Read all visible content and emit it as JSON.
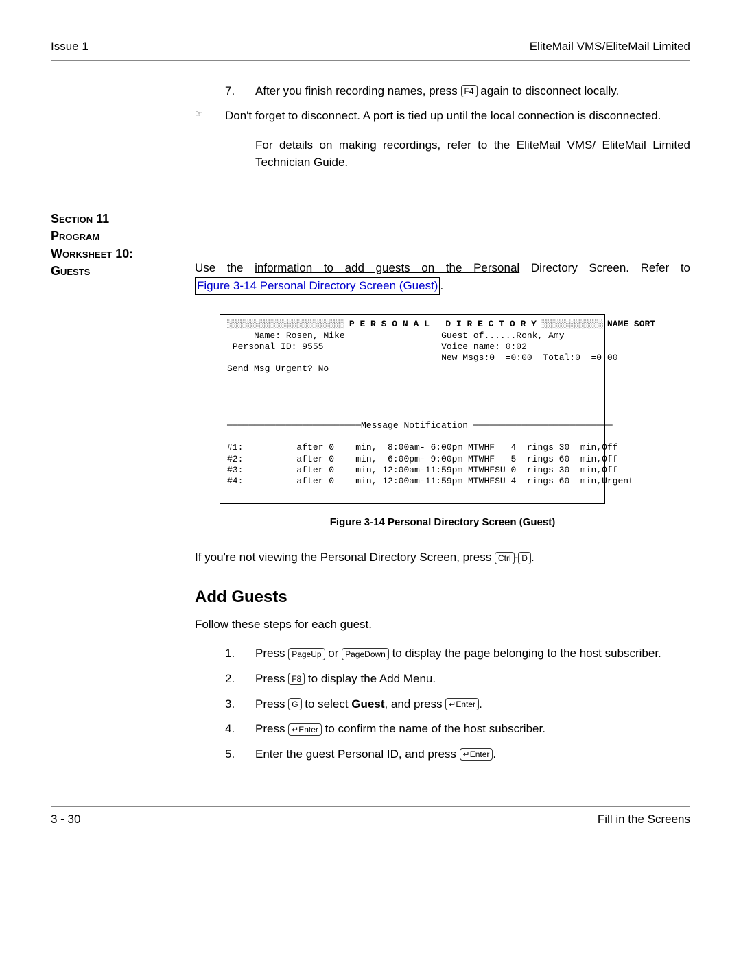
{
  "header": {
    "left": "Issue 1",
    "right": "EliteMail VMS/EliteMail Limited"
  },
  "step7": {
    "num": "7.",
    "before": "After you finish recording names, press ",
    "key": "F4",
    "after": " again to disconnect locally."
  },
  "note": {
    "icon": "☞",
    "text": "Don't forget to disconnect. A port is tied up until the local connection is disconnected."
  },
  "detailsPara": "For details on making recordings, refer to the EliteMail VMS/ EliteMail Limited Technician Guide.",
  "section": {
    "line1": "Section 11",
    "line2": "Program",
    "line3": "Worksheet 10:",
    "line4": "Guests"
  },
  "guestsPara": {
    "before": "Use the ",
    "underlined": "information to add guests on the Personal",
    "after": " Directory Screen. Refer to ",
    "link": "Figure 3-14 Personal Directory Screen (Guest)",
    "end": "."
  },
  "figure": {
    "headerHatchLeft": "░░░░░░░░░░░░░░░░░░░░░░░░░",
    "headerTitle": " P E R S O N A L   D I R E C T O R Y ",
    "headerHatchRight": "░░░░░░░░░░░░░ ",
    "headerSort": "NAME SORT",
    "line1L": "     Name: Rosen, Mike",
    "line1R": "Guest of......Ronk, Amy",
    "line2L": " Personal ID: 9555",
    "line2R": "Voice name: 0:02",
    "line3R": "New Msgs:0  =0:00  Total:0  =0:00",
    "line4": "Send Msg Urgent? No",
    "notifHeader": "─────────────────────────Message Notification ──────────────────────────",
    "rows": [
      "#1:          after 0    min,  8:00am- 6:00pm MTWHF   4  rings 30  min,Off",
      "#2:          after 0    min,  6:00pm- 9:00pm MTWHF   5  rings 60  min,Off",
      "#3:          after 0    min, 12:00am-11:59pm MTWHFSU 0  rings 30  min,Off",
      "#4:          after 0    min, 12:00am-11:59pm MTWHFSU 4  rings 60  min,Urgent"
    ],
    "caption": "Figure 3-14   Personal Directory Screen (Guest)"
  },
  "notViewing": {
    "before": "If you're not viewing the Personal Directory Screen, press ",
    "k1": "Ctrl",
    "dash": "-",
    "k2": "D",
    "after": "."
  },
  "addGuests": "Add Guests",
  "followSteps": "Follow these steps for each guest.",
  "steps": [
    {
      "num": "1.",
      "parts": [
        "Press ",
        "PageUp",
        " or ",
        "PageDown",
        " to display the page belonging to the host subscriber."
      ]
    },
    {
      "num": "2.",
      "parts": [
        "Press ",
        "F8",
        " to display the Add Menu."
      ]
    },
    {
      "num": "3.",
      "parts": [
        "Press ",
        "G",
        " to select ",
        "Guest",
        ", and press ",
        "↵Enter",
        "."
      ]
    },
    {
      "num": "4.",
      "parts": [
        "Press ",
        "↵Enter",
        " to confirm the name of the host subscriber."
      ]
    },
    {
      "num": "5.",
      "parts": [
        "Enter the guest Personal ID, and press ",
        "↵Enter",
        "."
      ]
    }
  ],
  "footer": {
    "left": "3 - 30",
    "right": "Fill in the Screens"
  }
}
